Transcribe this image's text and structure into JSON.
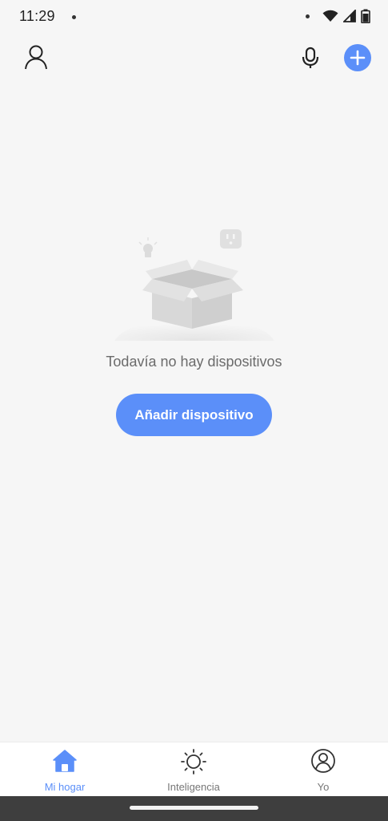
{
  "status_bar": {
    "time": "11:29"
  },
  "top_bar": {
    "profile_icon": "user-icon",
    "mic_icon": "microphone-icon",
    "add_icon": "plus-icon"
  },
  "empty_state": {
    "illustration": "empty-box-illustration",
    "message": "Todavía no hay dispositivos",
    "button_label": "Añadir dispositivo"
  },
  "bottom_nav": {
    "items": [
      {
        "label": "Mi hogar",
        "icon": "home-icon",
        "active": true
      },
      {
        "label": "Inteligencia",
        "icon": "sun-icon",
        "active": false
      },
      {
        "label": "Yo",
        "icon": "user-circle-icon",
        "active": false
      }
    ]
  },
  "colors": {
    "accent": "#5b8ff9",
    "background": "#f6f6f6",
    "text_muted": "#6b6b6b"
  }
}
